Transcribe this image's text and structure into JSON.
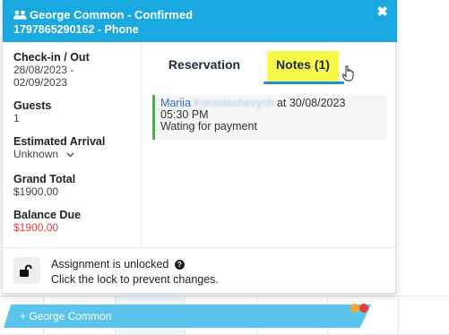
{
  "header": {
    "title": "George Common - Confirmed",
    "subtitle": "1797865290162 - Phone",
    "icon": "users-icon",
    "close_label": "✖"
  },
  "details": {
    "checkin_label": "Check-in / Out",
    "checkin_start": "28/08/2023 -",
    "checkin_end": "02/09/2023",
    "guests_label": "Guests",
    "guests_value": "1",
    "arrival_label": "Estimated Arrival",
    "arrival_value": "Unknown",
    "grand_total_label": "Grand Total",
    "grand_total_value": "$1900,00",
    "balance_due_label": "Balance Due",
    "balance_due_value": "$1900,00"
  },
  "tabs": [
    {
      "label": "Reservation",
      "active": false
    },
    {
      "label": "Notes (1)",
      "active": true
    }
  ],
  "note": {
    "author_first": "Mariia",
    "author_last": "Korostashevych",
    "at_text": "at 30/08/2023",
    "time": "05:30 PM",
    "text": "Wating for payment"
  },
  "assignment": {
    "line1": "Assignment is unlocked",
    "line2": "Click the lock to prevent changes.",
    "help_glyph": "?"
  },
  "calendar": {
    "booking_label": "+ George Common"
  },
  "colors": {
    "header_bg": "#1aa8e0",
    "tab_highlight": "#f6f84a",
    "tab_underline": "#1f8fd6",
    "balance_red": "#e33b3b",
    "note_border": "#4caf50",
    "booking_bar": "#5bc4ec",
    "dot_orange": "#f2a531",
    "dot_red": "#ec3b3b"
  }
}
